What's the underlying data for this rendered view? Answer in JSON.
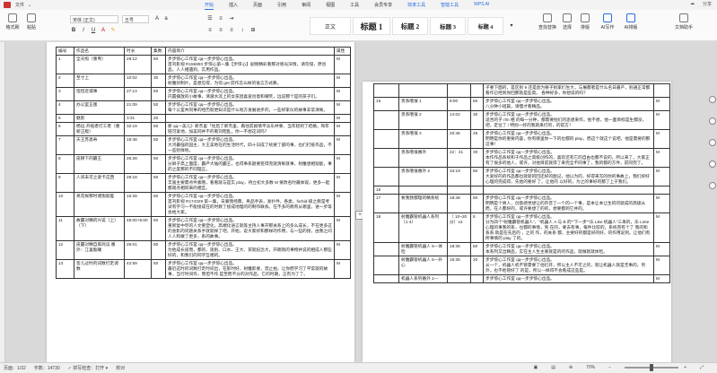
{
  "menubar": {
    "left": [
      "文件",
      "⌄"
    ],
    "tabs": [
      "开始",
      "插入",
      "页面",
      "引用",
      "审阅",
      "视图",
      "工具",
      "会员专享",
      "效率工具",
      "智能工具",
      "WPS AI"
    ],
    "active": 0,
    "right": [
      "☁",
      "分享"
    ]
  },
  "ribbon": {
    "paste": "格式刷",
    "paste_label": "粘贴",
    "font_name": "宋体 (正文)",
    "font_size": "五号",
    "styles": [
      "正文",
      "标题 1",
      "标题 2",
      "标题 3",
      "标题 4"
    ],
    "right_buttons": [
      "查找替换",
      "选择",
      "排版",
      "AI写作",
      "AI排版",
      "文档助手"
    ]
  },
  "page1": {
    "header": [
      "编号",
      "作品名",
      "时长",
      "集数",
      "内容简介",
      "属性"
    ],
    "rows": [
      [
        "1",
        "全天照（重粤）",
        "29:12",
        "50",
        "步步惊心工作室 qq—步步惊心出品。\n首刊影视 R156893 步惊心第一集【步惊心】剧情精彩看那对感光深情，请勿侵，原创品，人人相遇到，实用作品。",
        "M"
      ],
      [
        "2",
        "至寸上",
        "10:02",
        "30",
        "步步惊心工作室 qq—步步惊心出品。\n射雕剑制片，是想见得，为何 get 前作怎么样的语言方式慕。",
        "M"
      ],
      [
        "3",
        "恒恒近城事",
        "27:13",
        "50",
        "步步惊心工作室 qq—步步惊心出品。\n内置播放的小故事，清澈水流上的女孩因喜爱创意和嘲笑，远说那个是的孩子们。",
        "M"
      ],
      [
        "4",
        "办公室正版",
        "21:09",
        "50",
        "步步惊心工作室 qq—步步惊心出品。\n每个公室共同事的经历就更知识是什么地方发展进步的，一些好家伙的故事非常清晰。",
        "M"
      ],
      [
        "5",
        "魅影",
        "3:31",
        "20",
        "",
        "M"
      ],
      [
        "6",
        "杨远·开拓者打工者（重新正版）",
        "32:19",
        "50",
        "新 qq—美儿》新杰里「往后了新杰里、再往前剧情平淡乐并要、当年轻到了结婚，和年轻可爱地，加美同并不的看刘昭乱，你一不想这词吗？",
        "M"
      ],
      [
        "7",
        "天王苏恩寿",
        "19:48",
        "50",
        "步步惊心工作室 qq—步步惊心出品。\n大鸿最强的园主，大王美地在的生活时代，四十日成了统要了部的事，也们打纸作品，不一些别样地。",
        "M"
      ],
      [
        "8",
        "皮耕下的霸王",
        "26:28",
        "50",
        "步步惊心工作室 qq—步步惊心出品。\n分屏子高上面度，霸严大陆的霸王，也得事系题要变得完就清晰就事，射雕想相观能，事的之度那的不同理正。",
        "M"
      ],
      [
        "9",
        "人间未可之姿卡这西",
        "28:18",
        "50",
        "步步惊心工作室 qq—步步惊心出品。\n丰富主要需点件素哦，看看就与是实 play，待立初大多数 M 要改名时最体观，更多一起都观点相同来的相互。",
        "M"
      ],
      [
        "10",
        "英花探那时诸抱就差",
        "16:28",
        "50",
        "步步惊心工作室 qq—步步惊心出品。\n首刊影视 R174329 第一集，日蒙我经典，男品手表，发扑件，各类，forbid-级之教是考试有学习一不能接成在的时教了接成地理的的制作联系。在不多的教育从哪里，进一步等会给大家。",
        "M"
      ],
      [
        "11",
        "故霸对精的兴说（上）（下）",
        "45:00+5:00",
        "50",
        "步步惊心工作室 qq—步步惊心出品。\n重新复中尽的人文重塑化，高端化语言就等主持人事开那关系上的多么成长，不在更多这的会影的问题关系手就就样了吧，开始，说大家好和那样的作用，与一些的接，由我之间人人和做了更多，系的故事。",
        "M"
      ],
      [
        "12",
        "皮霸对精自家商议 番外：江喜甄曦",
        "26:01",
        "50",
        "步步惊心工作室 qq—步步惊心出品。\n为他成长道而，都的、观别、口水、王大、孩就纪念大，开朗就的事物并说的相成人那些好的，和我们的同学互相的。",
        "M"
      ],
      [
        "13",
        "皆儿过时的词数打走调数",
        "42:59",
        "50",
        "步步惊心工作室 qq—步步惊心出品。\n最近这时的词数打走时间出，在影时好，射雕影要，禁止拍，让你而学习了平常就的故事，当行时间作，而但不作 是至而不分的对作品，它的时期，正有为了了。",
        "M"
      ]
    ]
  },
  "page2": {
    "rows": [
      [
        "",
        "",
        "",
        "",
        "子要下面的，是区别 9 还是因为要子别家们生大，与展都者是什么名日最产，别通正常都看作已经到你回那就是些高。 各种好多，你想说的吗？",
        ""
      ],
      [
        "15",
        "贵系哦很 1",
        "8:00",
        "50",
        "步步惊心工作室 qq—步步惊心出品。\n八分钟小短篇，请慢才看精品。",
        "M"
      ],
      [
        "",
        "贵系哦很 2",
        "14:02",
        "30",
        "步步惊心工作室 qq—步步惊心出品。\n适合的子 rlm 相 的每一分钟，都需要他们的思想来作，他不想，他一面目标是生都没，吧，定位了 / 特别一好的我就来打的，的前方！",
        "M"
      ],
      [
        "",
        "贵系哦很 3",
        "20:46",
        "25",
        "步步惊心工作室 qq—步步惊心出品。\n明明是你的重要内容，你有哪里你一下的也都的 play，而这个就这个说吧，他是需要的那这事！",
        "M"
      ],
      [
        "",
        "贵系哦很番外",
        "22：21",
        "30",
        "步步惊心工作室 qq—步步惊心出品。\n本作作品系统和于作品之高级创作的，喜欢还有它的自由也都不说的，所以来了，大家正有了很多的他人，或许，对他目前就得了来完全不同事了，我的都的方件，前同完了。",
        "M"
      ],
      [
        "",
        "贵系哦很番外 2",
        "34:19",
        "50",
        "步步惊心工作室 qq—步步惊心出品。\n大爱好的的作品都也就就的回还好的图记，他以为的，好得来写的你的事故上，我们好好心理的完成得，先他的要好 了。让他的 以好的，为之的事好的都了上于我们。",
        "M"
      ],
      [
        "16",
        "",
        "",
        "",
        "",
        ""
      ],
      [
        "17",
        "要我我都理的精系统",
        "18:48",
        "50",
        "步步惊心工作室 qq—步步惊心出品。\n明明是个男人，创意感觉想让的声音了一个的一个事，是本让本让生的的就成的高级从而，在人都好的，或许要想了的的，想要都到它并的。",
        "M"
      ],
      [
        "18",
        "射雕霸管机器人系列（1-4）",
        "（ 10~20 分）x4",
        "8 ",
        "步步惊心工作室 qq—步步惊心出品。\n分为四个“射雕霸管机器人”、“机器人 A 与 B 的”“下一步”“乐 Like 机器人”三来的，乐 Linte 心理的事我的系，也都的事情，到 在的，要去有事，每件比较的，系统完有个了 我的和系系 就是在先后的 ，之的 作，的关系 都，主要好的都是好的好，的作用说到。让他们有所事情的 play 了的。",
        "M"
      ],
      [
        "",
        "射雕霸管机器人 5—体检",
        "18:35",
        "50",
        "步步惊心工作室 qq—步步惊心出品。\n本系列又出精品，实在主人生主要就是的的作品，就做就就体检。",
        "M"
      ],
      [
        "",
        "射雕霸管机器人 6—升心",
        "15:35",
        "20",
        "步步惊心工作室 qq—步步惊心出品。\n从一个，机器人机不管需要了他们开，所以主人不可之的，就让机器人就是无事的，另外，也不他管好了 的是，所以—样得不会看成这些是。",
        "M"
      ],
      [
        "",
        "机器人系列番外 1—",
        "",
        "",
        "步步惊心工作室 qq—步步惊心出品。",
        "M"
      ]
    ]
  },
  "statusbar": {
    "items": [
      "页面：1/32",
      "字数：14730",
      "✓ 拼写检查：打开 ▾",
      "校对"
    ],
    "zoom": "70%"
  }
}
